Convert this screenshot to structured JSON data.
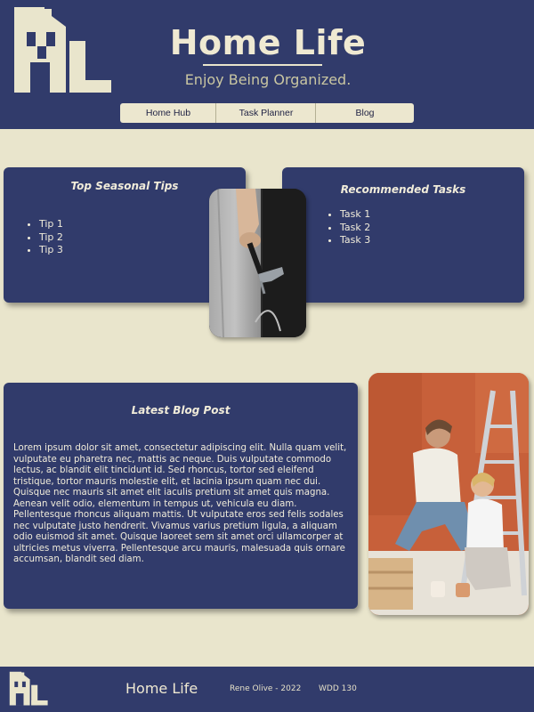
{
  "header": {
    "title": "Home Life",
    "tagline": "Enjoy Being Organized.",
    "logo_icon": "house-hl-logo-icon"
  },
  "nav": {
    "items": [
      {
        "label": "Home Hub"
      },
      {
        "label": "Task Planner"
      },
      {
        "label": "Blog"
      }
    ]
  },
  "tips": {
    "title": "Top Seasonal Tips",
    "items": [
      "Tip 1",
      "Tip 2",
      "Tip 3"
    ]
  },
  "tasks": {
    "title": "Recommended Tasks",
    "items": [
      "Task 1",
      "Task 2",
      "Task 3"
    ]
  },
  "blog": {
    "title": "Latest Blog Post",
    "body": "Lorem ipsum dolor sit amet, consectetur adipiscing elit. Nulla quam velit, vulputate eu pharetra nec, mattis ac neque. Duis vulputate commodo lectus, ac blandit elit tincidunt id. Sed rhoncus, tortor sed eleifend tristique, tortor mauris molestie elit, et lacinia ipsum quam nec dui. Quisque nec mauris sit amet elit iaculis pretium sit amet quis magna. Aenean velit odio, elementum in tempus ut, vehicula eu diam. Pellentesque rhoncus aliquam mattis. Ut vulputate eros sed felis sodales nec vulputate justo hendrerit. Vivamus varius pretium ligula, a aliquam odio euismod sit amet. Quisque laoreet sem sit amet orci ullamcorper at ultricies metus viverra. Pellentesque arcu mauris, malesuada quis ornare accumsan, blandit sed diam."
  },
  "footer": {
    "title": "Home Life",
    "credit": "Rene Olive - 2022",
    "course": "WDD 130"
  },
  "colors": {
    "navy": "#313b6b",
    "cream": "#e9e5cc",
    "text_light": "#f1ecda"
  }
}
